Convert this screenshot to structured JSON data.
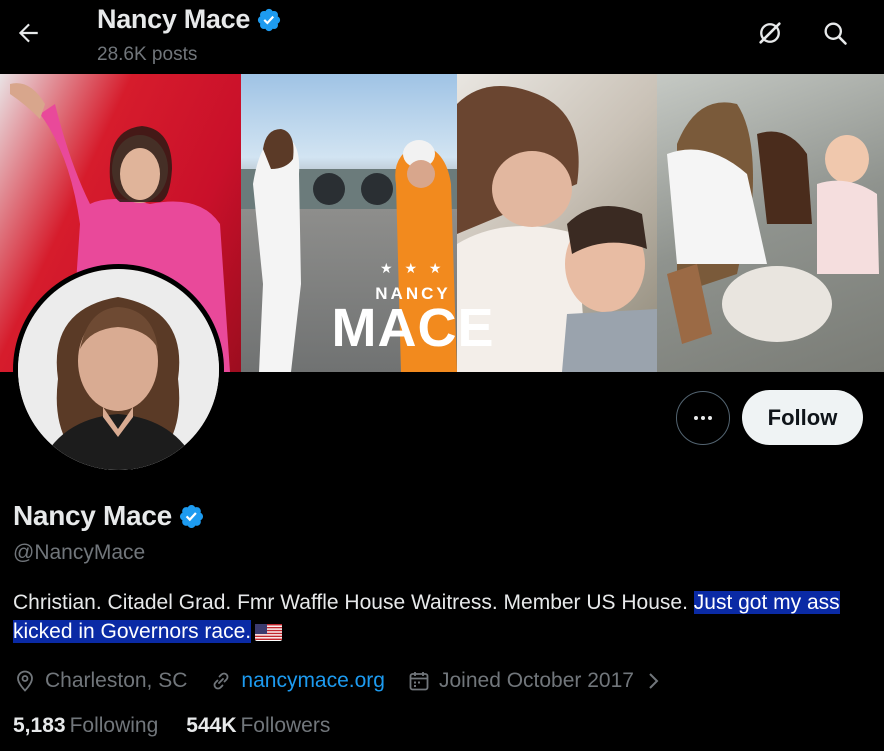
{
  "header": {
    "name": "Nancy Mace",
    "posts": "28.6K posts"
  },
  "banner": {
    "small_text": "NANCY",
    "big_text": "MACE",
    "stars": "★ ★ ★"
  },
  "profile": {
    "display_name": "Nancy Mace",
    "handle": "@NancyMace",
    "bio_plain": "Christian. Citadel Grad. Fmr Waffle House Waitress. Member US House. ",
    "bio_highlighted": "Just got my ass kicked in Governors race.",
    "location": "Charleston, SC",
    "website": "nancymace.org",
    "joined": "Joined October 2017"
  },
  "actions": {
    "follow_label": "Follow"
  },
  "stats": {
    "following_count": "5,183",
    "following_label": "Following",
    "followers_count": "544K",
    "followers_label": "Followers"
  },
  "icons": {
    "back": "arrow-left-icon",
    "grok": "grok-icon",
    "search": "search-icon",
    "verified": "verified-badge-icon",
    "more": "more-horizontal-icon",
    "location": "location-pin-icon",
    "link": "link-icon",
    "calendar": "calendar-icon",
    "chevron": "chevron-right-icon",
    "flag": "us-flag-emoji"
  },
  "colors": {
    "background": "#000000",
    "text_primary": "#e7e9ea",
    "text_secondary": "#71767b",
    "accent": "#1d9bf0",
    "verified": "#1d9bf0",
    "selection": "#0a2aa5",
    "follow_bg": "#eff3f4"
  }
}
